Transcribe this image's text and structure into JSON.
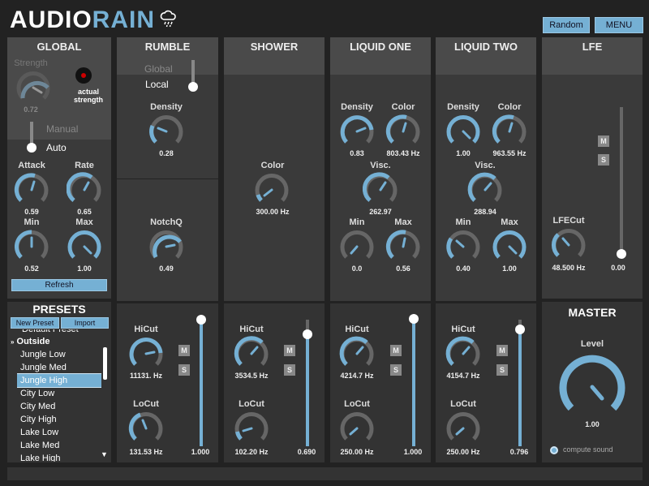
{
  "app": {
    "brand_a": "AUDIO",
    "brand_b": "RAIN"
  },
  "top_buttons": {
    "random": "Random",
    "menu": "MENU"
  },
  "global": {
    "title": "GLOBAL",
    "strength_label": "Strength",
    "strength_value": "0.72",
    "actual_strength": "actual strength",
    "manual": "Manual",
    "auto": "Auto",
    "attack_label": "Attack",
    "attack_value": "0.59",
    "rate_label": "Rate",
    "rate_value": "0.65",
    "min_label": "Min",
    "min_value": "0.52",
    "max_label": "Max",
    "max_value": "1.00",
    "refresh": "Refresh"
  },
  "presets": {
    "title": "PRESETS",
    "new_preset": "New Preset",
    "import": "Import",
    "partial_top": "Default Preset",
    "group": "Outside",
    "items": [
      "Jungle Low",
      "Jungle Med",
      "Jungle High",
      "City Low",
      "City Med",
      "City High",
      "Lake Low",
      "Lake Med",
      "Lake High"
    ],
    "selected_index": 2
  },
  "rumble": {
    "title": "RUMBLE",
    "global": "Global",
    "local": "Local",
    "density_label": "Density",
    "density_value": "0.28",
    "notchq_label": "NotchQ",
    "notchq_value": "0.49",
    "hicut_label": "HiCut",
    "hicut_value": "11131. Hz",
    "locut_label": "LoCut",
    "locut_value": "131.53 Hz",
    "fader_value": "1.000"
  },
  "shower": {
    "title": "SHOWER",
    "color_label": "Color",
    "color_value": "300.00 Hz",
    "hicut_label": "HiCut",
    "hicut_value": "3534.5 Hz",
    "locut_label": "LoCut",
    "locut_value": "102.20 Hz",
    "fader_value": "0.690"
  },
  "liquid_one": {
    "title": "LIQUID ONE",
    "density_label": "Density",
    "density_value": "0.83",
    "color_label": "Color",
    "color_value": "803.43 Hz",
    "visc_label": "Visc.",
    "visc_value": "262.97",
    "min_label": "Min",
    "min_value": "0.0",
    "max_label": "Max",
    "max_value": "0.56",
    "hicut_label": "HiCut",
    "hicut_value": "4214.7 Hz",
    "locut_label": "LoCut",
    "locut_value": "250.00 Hz",
    "fader_value": "1.000"
  },
  "liquid_two": {
    "title": "LIQUID TWO",
    "density_label": "Density",
    "density_value": "1.00",
    "color_label": "Color",
    "color_value": "963.55 Hz",
    "visc_label": "Visc.",
    "visc_value": "288.94",
    "min_label": "Min",
    "min_value": "0.40",
    "max_label": "Max",
    "max_value": "1.00",
    "hicut_label": "HiCut",
    "hicut_value": "4154.7 Hz",
    "locut_label": "LoCut",
    "locut_value": "250.00 Hz",
    "fader_value": "0.796"
  },
  "lfe": {
    "title": "LFE",
    "lfecut_label": "LFECut",
    "lfecut_value": "48.500 Hz",
    "fader_value": "0.00"
  },
  "master": {
    "title": "MASTER",
    "level_label": "Level",
    "level_value": "1.00",
    "compute_sound": "compute sound"
  },
  "ms": {
    "m": "M",
    "s": "S"
  },
  "colors": {
    "accent": "#75b0d4",
    "track": "#666666",
    "panel": "#3a3a3a"
  }
}
